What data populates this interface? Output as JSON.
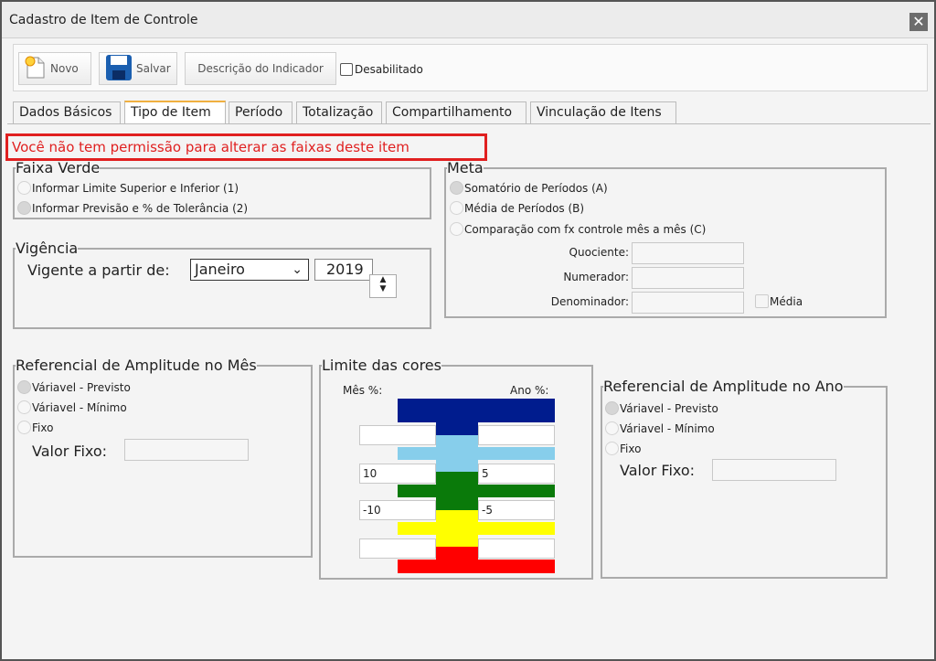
{
  "window": {
    "title": "Cadastro de Item de Controle",
    "close_glyph": "✕"
  },
  "toolbar": {
    "novo_label": "Novo",
    "salvar_label": "Salvar",
    "descricao_label": "Descrição do Indicador",
    "desabilitado_label": "Desabilitado",
    "desabilitado_checked": false
  },
  "tabs": [
    {
      "label": "Dados Básicos"
    },
    {
      "label": "Tipo de Item",
      "active": true
    },
    {
      "label": "Período"
    },
    {
      "label": "Totalização"
    },
    {
      "label": "Compartilhamento"
    },
    {
      "label": "Vinculação de Itens"
    }
  ],
  "permission_message": "Você não tem permissão para alterar as faixas deste item",
  "faixa_verde": {
    "legend": "Faixa Verde",
    "options": [
      {
        "label": "Informar Limite Superior e Inferior (1)",
        "selected": false
      },
      {
        "label": "Informar Previsão e % de Tolerância (2)",
        "selected": true
      }
    ]
  },
  "meta": {
    "legend": "Meta",
    "options": [
      {
        "label": "Somatório de Períodos (A)",
        "selected": true
      },
      {
        "label": "Média de Períodos (B)",
        "selected": false
      },
      {
        "label": "Comparação com fx controle mês a mês (C)",
        "selected": false
      }
    ],
    "quociente_label": "Quociente:",
    "quociente_value": "",
    "numerador_label": "Numerador:",
    "numerador_value": "",
    "denominador_label": "Denominador:",
    "denominador_value": "",
    "media_label": "Média",
    "media_checked": false
  },
  "vigencia": {
    "legend": "Vigência",
    "label": "Vigente a partir de:",
    "month": "Janeiro",
    "year": "2019"
  },
  "ref_mes": {
    "legend": "Referencial de Amplitude no Mês",
    "options": [
      {
        "label": "Váriavel - Previsto",
        "selected": true
      },
      {
        "label": "Váriavel - Mínimo",
        "selected": false
      },
      {
        "label": "Fixo",
        "selected": false
      }
    ],
    "valor_fixo_label": "Valor Fixo:",
    "valor_fixo_value": ""
  },
  "limite": {
    "legend": "Limite das cores",
    "mes_label": "Mês %:",
    "ano_label": "Ano %:",
    "mes_values": [
      "",
      "10",
      "-10",
      ""
    ],
    "ano_values": [
      "",
      "5",
      "-5",
      ""
    ],
    "colors": {
      "blue": "#001c8e",
      "light_blue": "#87ceeb",
      "green": "#0a7a0a",
      "yellow": "#ffff00",
      "red": "#ff0000"
    }
  },
  "ref_ano": {
    "legend": "Referencial de Amplitude no Ano",
    "options": [
      {
        "label": "Váriavel - Previsto",
        "selected": true
      },
      {
        "label": "Váriavel - Mínimo",
        "selected": false
      },
      {
        "label": "Fixo",
        "selected": false
      }
    ],
    "valor_fixo_label": "Valor Fixo:",
    "valor_fixo_value": ""
  }
}
